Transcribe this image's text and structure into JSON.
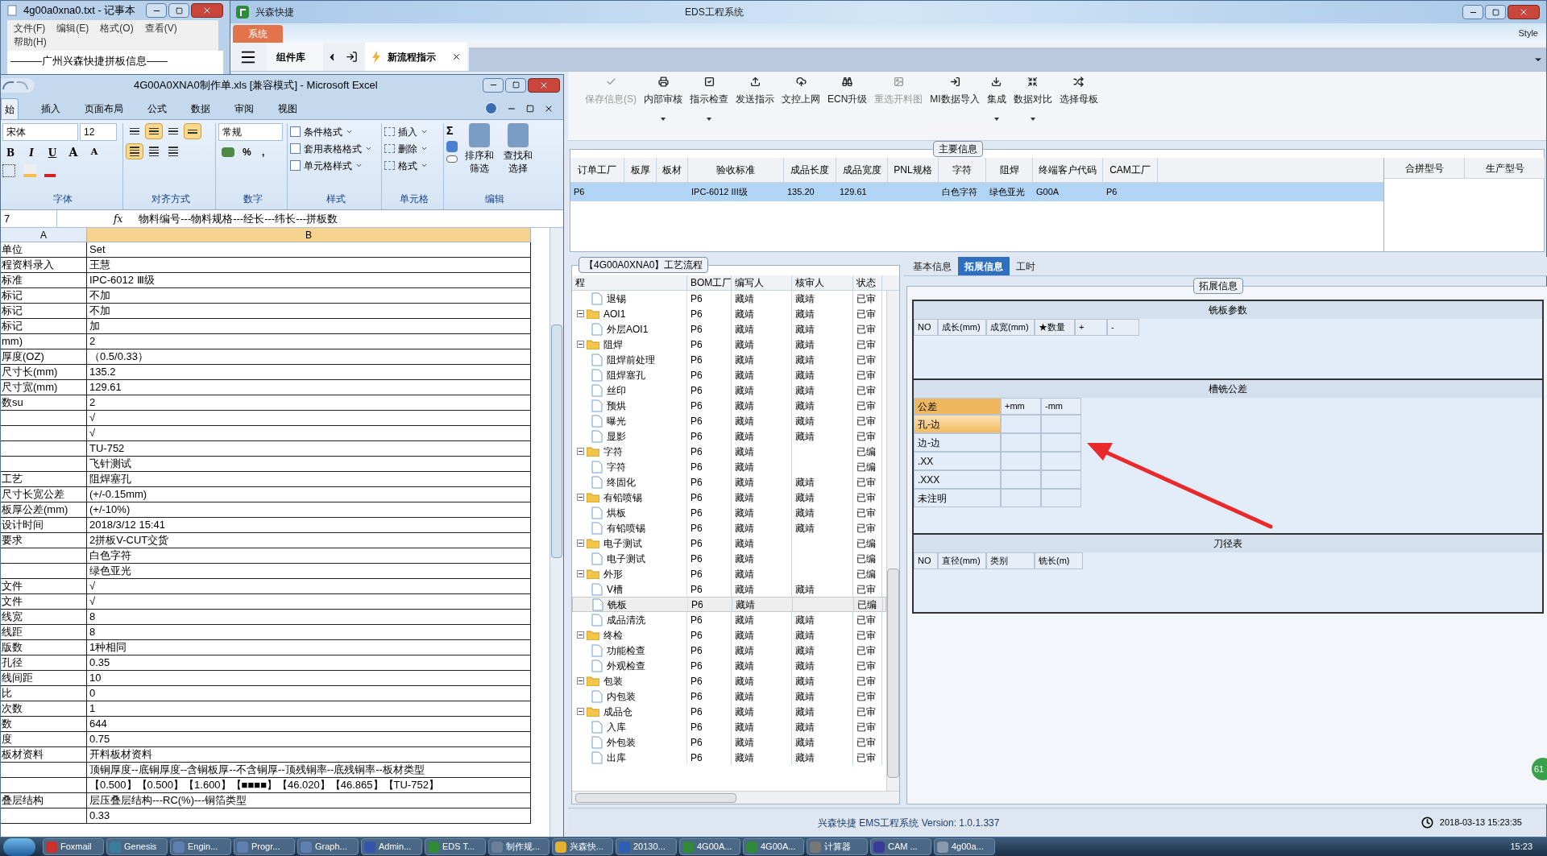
{
  "notepad": {
    "title": "4g00a0xna0.txt - 记事本",
    "menu": [
      "文件(F)",
      "编辑(E)",
      "格式(O)",
      "查看(V)",
      "帮助(H)"
    ],
    "text": "———广州兴森快捷拼板信息——"
  },
  "eds": {
    "app_name": "兴森快捷",
    "title": "EDS工程系统",
    "background_text": "Style",
    "system_tab": "系统",
    "library": "组件库",
    "doc_tabs": [
      {
        "label": "新流程指示",
        "selected": true
      }
    ],
    "toolbar": [
      {
        "label": "保存信息(S)",
        "disabled": true,
        "dropdown": false
      },
      {
        "label": "内部审核",
        "disabled": false,
        "dropdown": true
      },
      {
        "label": "指示检查",
        "disabled": false,
        "dropdown": true
      },
      {
        "label": "发送指示",
        "disabled": false,
        "dropdown": false
      },
      {
        "label": "文控上网",
        "disabled": false,
        "dropdown": false
      },
      {
        "label": "ECN升级",
        "disabled": false,
        "dropdown": false
      },
      {
        "label": "重选开料图",
        "disabled": true,
        "dropdown": false
      },
      {
        "label": "MI数据导入",
        "disabled": false,
        "dropdown": false
      },
      {
        "label": "集成",
        "disabled": false,
        "dropdown": true
      },
      {
        "label": "数据对比",
        "disabled": false,
        "dropdown": true
      },
      {
        "label": "选择母板",
        "disabled": false,
        "dropdown": false
      }
    ],
    "main_info": {
      "title": "主要信息",
      "columns": [
        "订单工厂",
        "板厚",
        "板材",
        "验收标准",
        "成品长度",
        "成品宽度",
        "PNL规格",
        "字符",
        "阻焊",
        "终端客户代码",
        "CAM工厂"
      ],
      "rows": [
        {
          "selected": true,
          "cells": [
            "P6",
            "",
            "",
            "IPC-6012 III级",
            "135.20",
            "129.61",
            "",
            "白色字符",
            "绿色亚光",
            "G00A",
            "P6"
          ]
        }
      ],
      "side_columns": [
        "合拼型号",
        "生产型号"
      ]
    },
    "process": {
      "title": "【4G00A0XNA0】工艺流程",
      "columns": [
        "程",
        "BOM工厂",
        "编写人",
        "核审人",
        "状态"
      ],
      "tree": [
        {
          "children": [
            {
              "name": "退锡",
              "kind": "file",
              "bom": "P6",
              "writer": "藏靖",
              "reviewer": "藏靖",
              "status": "已审",
              "selected": false
            }
          ]
        },
        {
          "name": "AOI1",
          "kind": "folder",
          "expanded": true,
          "bom": "P6",
          "writer": "藏靖",
          "reviewer": "藏靖",
          "status": "已审",
          "selected": false,
          "children": [
            {
              "name": "外层AOI1",
              "kind": "file",
              "bom": "P6",
              "writer": "藏靖",
              "reviewer": "藏靖",
              "status": "已审",
              "selected": false
            }
          ]
        },
        {
          "name": "阻焊",
          "kind": "folder",
          "expanded": true,
          "bom": "P6",
          "writer": "藏靖",
          "reviewer": "藏靖",
          "status": "已审",
          "selected": false,
          "children": [
            {
              "name": "阻焊前处理",
              "kind": "file",
              "bom": "P6",
              "writer": "藏靖",
              "reviewer": "藏靖",
              "status": "已审",
              "selected": false
            },
            {
              "name": "阻焊塞孔",
              "kind": "file",
              "bom": "P6",
              "writer": "藏靖",
              "reviewer": "藏靖",
              "status": "已审",
              "selected": false
            },
            {
              "name": "丝印",
              "kind": "file",
              "bom": "P6",
              "writer": "藏靖",
              "reviewer": "藏靖",
              "status": "已审",
              "selected": false
            },
            {
              "name": "预烘",
              "kind": "file",
              "bom": "P6",
              "writer": "藏靖",
              "reviewer": "藏靖",
              "status": "已审",
              "selected": false
            },
            {
              "name": "曝光",
              "kind": "file",
              "bom": "P6",
              "writer": "藏靖",
              "reviewer": "藏靖",
              "status": "已审",
              "selected": false
            },
            {
              "name": "显影",
              "kind": "file",
              "bom": "P6",
              "writer": "藏靖",
              "reviewer": "藏靖",
              "status": "已审",
              "selected": false
            }
          ]
        },
        {
          "name": "字符",
          "kind": "folder",
          "expanded": true,
          "bom": "P6",
          "writer": "藏靖",
          "status": "已编",
          "selected": false,
          "children": [
            {
              "name": "字符",
              "kind": "file",
              "bom": "P6",
              "writer": "藏靖",
              "status": "已编",
              "selected": false
            },
            {
              "name": "终固化",
              "kind": "file",
              "bom": "P6",
              "writer": "藏靖",
              "reviewer": "藏靖",
              "status": "已审",
              "selected": false
            }
          ]
        },
        {
          "name": "有铅喷锡",
          "kind": "folder",
          "expanded": true,
          "bom": "P6",
          "writer": "藏靖",
          "reviewer": "藏靖",
          "status": "已审",
          "selected": false,
          "children": [
            {
              "name": "烘板",
              "kind": "file",
              "bom": "P6",
              "writer": "藏靖",
              "reviewer": "藏靖",
              "status": "已审",
              "selected": false
            },
            {
              "name": "有铅喷锡",
              "kind": "file",
              "bom": "P6",
              "writer": "藏靖",
              "reviewer": "藏靖",
              "status": "已审",
              "selected": false
            }
          ]
        },
        {
          "name": "电子测试",
          "kind": "folder",
          "expanded": true,
          "bom": "P6",
          "writer": "藏靖",
          "status": "已编",
          "selected": false,
          "children": [
            {
              "name": "电子测试",
              "kind": "file",
              "bom": "P6",
              "writer": "藏靖",
              "status": "已编",
              "selected": false
            }
          ]
        },
        {
          "name": "外形",
          "kind": "folder",
          "expanded": true,
          "bom": "P6",
          "writer": "藏靖",
          "status": "已编",
          "selected": false,
          "children": [
            {
              "name": "V槽",
              "kind": "file",
              "bom": "P6",
              "writer": "藏靖",
              "reviewer": "藏靖",
              "status": "已审",
              "selected": false
            },
            {
              "name": "铣板",
              "kind": "file",
              "bom": "P6",
              "writer": "藏靖",
              "status": "已编",
              "selected": true
            },
            {
              "name": "成品清洗",
              "kind": "file",
              "bom": "P6",
              "writer": "藏靖",
              "reviewer": "藏靖",
              "status": "已审",
              "selected": false
            }
          ]
        },
        {
          "name": "终检",
          "kind": "folder",
          "expanded": true,
          "bom": "P6",
          "writer": "藏靖",
          "reviewer": "藏靖",
          "status": "已审",
          "selected": false,
          "children": [
            {
              "name": "功能检查",
              "kind": "file",
              "bom": "P6",
              "writer": "藏靖",
              "reviewer": "藏靖",
              "status": "已审",
              "selected": false
            },
            {
              "name": "外观检查",
              "kind": "file",
              "bom": "P6",
              "writer": "藏靖",
              "reviewer": "藏靖",
              "status": "已审",
              "selected": false
            }
          ]
        },
        {
          "name": "包装",
          "kind": "folder",
          "expanded": true,
          "bom": "P6",
          "writer": "藏靖",
          "reviewer": "藏靖",
          "status": "已审",
          "selected": false,
          "children": [
            {
              "name": "内包装",
              "kind": "file",
              "bom": "P6",
              "writer": "藏靖",
              "reviewer": "藏靖",
              "status": "已审",
              "selected": false
            }
          ]
        },
        {
          "name": "成品仓",
          "kind": "folder",
          "expanded": true,
          "bom": "P6",
          "writer": "藏靖",
          "reviewer": "藏靖",
          "status": "已审",
          "selected": false,
          "children": [
            {
              "name": "入库",
              "kind": "file",
              "bom": "P6",
              "writer": "藏靖",
              "reviewer": "藏靖",
              "status": "已审",
              "selected": false
            },
            {
              "name": "外包装",
              "kind": "file",
              "bom": "P6",
              "writer": "藏靖",
              "reviewer": "藏靖",
              "status": "已审",
              "selected": false
            },
            {
              "name": "出库",
              "kind": "file",
              "bom": "P6",
              "writer": "藏靖",
              "reviewer": "藏靖",
              "status": "已审",
              "selected": false
            }
          ]
        }
      ]
    },
    "detail": {
      "tabs": [
        {
          "label": "基本信息",
          "selected": false
        },
        {
          "label": "拓展信息",
          "selected": true
        },
        {
          "label": "工时",
          "selected": false
        }
      ],
      "group_title": "拓展信息",
      "milling": {
        "title": "铣板参数",
        "columns": [
          "NO",
          "成长(mm)",
          "成宽(mm)",
          "★数量",
          "+",
          "-"
        ]
      },
      "tolerance": {
        "title": "槽铣公差",
        "columns": [
          "公差",
          "+mm",
          "-mm"
        ],
        "rows": [
          {
            "label": "孔-边",
            "selected": true
          },
          {
            "label": "边-边",
            "selected": false
          },
          {
            "label": ".XX",
            "selected": false
          },
          {
            "label": ".XXX",
            "selected": false
          },
          {
            "label": "未注明",
            "selected": false
          }
        ]
      },
      "tools": {
        "title": "刀径表",
        "columns": [
          "NO",
          "直径(mm)",
          "类别",
          "铣长(m)"
        ]
      }
    },
    "status_bar": {
      "text": "兴森快捷 EMS工程系统 Version: 1.0.1.337",
      "datetime": "2018-03-13 15:23:35"
    },
    "badge": "61"
  },
  "excel": {
    "title": "4G00A0XNA0制作单.xls  [兼容模式] - Microsoft Excel",
    "tabs": [
      {
        "label": "始",
        "selected": true
      },
      {
        "label": "插入",
        "selected": false
      },
      {
        "label": "页面布局",
        "selected": false
      },
      {
        "label": "公式",
        "selected": false
      },
      {
        "label": "数据",
        "selected": false
      },
      {
        "label": "审阅",
        "selected": false
      },
      {
        "label": "视图",
        "selected": false
      }
    ],
    "ribbon": {
      "font": {
        "label": "字体",
        "font": "宋体",
        "size": "12",
        "styles": [
          "B",
          "I",
          "U"
        ],
        "grow": [
          "A",
          "A"
        ]
      },
      "alignment": {
        "label": "对齐方式",
        "vertical": [
          {
            "selected": false
          },
          {
            "selected": true
          },
          {
            "selected": false
          }
        ],
        "wrap": {
          "selected": true
        },
        "horizontal": [
          {
            "selected": true
          },
          {
            "selected": false
          },
          {
            "selected": false
          }
        ]
      },
      "number": {
        "label": "数字",
        "format": "常规",
        "symbols": [
          "%",
          ","
        ]
      },
      "styles": {
        "label": "样式",
        "items": [
          "条件格式",
          "套用表格格式",
          "单元格样式"
        ]
      },
      "cells": {
        "label": "单元格",
        "items": [
          "插入",
          "删除",
          "格式"
        ]
      },
      "editing": {
        "label": "编辑",
        "sum": "Σ",
        "items": [
          "排序和筛选",
          "查找和选择"
        ]
      }
    },
    "name_box": "7",
    "function_label": "fx",
    "formula": "物料编号---物料规格---经长---纬长---拼板数",
    "columns": [
      "A",
      "B"
    ],
    "rows": [
      {
        "a": "单位",
        "b": "Set"
      },
      {
        "a": "程资料录入",
        "b": "王慧"
      },
      {
        "a": "标准",
        "b": "IPC-6012 Ⅲ级"
      },
      {
        "a": "标记",
        "b": "不加"
      },
      {
        "a": "标记",
        "b": "不加"
      },
      {
        "a": "标记",
        "b": "加"
      },
      {
        "a": "mm)",
        "b": "2"
      },
      {
        "a": "厚度(OZ)",
        "b": "（0.5/0.33）"
      },
      {
        "a": "尺寸长(mm)",
        "b": "135.2"
      },
      {
        "a": "尺寸宽(mm)",
        "b": "129.61"
      },
      {
        "a": "数su",
        "b": "2"
      },
      {
        "b": "√"
      },
      {
        "b": "√"
      },
      {
        "b": "TU-752"
      },
      {
        "b": "飞针测试"
      },
      {
        "a": "工艺",
        "b": "阻焊塞孔"
      },
      {
        "a": "尺寸长宽公差",
        "b": "(+/-0.15mm)"
      },
      {
        "a": "板厚公差(mm)",
        "b": "(+/-10%)"
      },
      {
        "a": "设计时间",
        "b": "2018/3/12 15:41"
      },
      {
        "a": "要求",
        "b": "2拼板V-CUT交货"
      },
      {
        "b": "白色字符"
      },
      {
        "b": "绿色亚光"
      },
      {
        "a": "文件",
        "b": "√"
      },
      {
        "a": "文件",
        "b": "√"
      },
      {
        "a": "线宽",
        "b": "8"
      },
      {
        "a": "线距",
        "b": "8"
      },
      {
        "a": "版数",
        "b": "1种相同"
      },
      {
        "a": "孔径",
        "b": "0.35"
      },
      {
        "a": "线间距",
        "b": "10"
      },
      {
        "a": "比",
        "b": "0"
      },
      {
        "a": "次数",
        "b": "1"
      },
      {
        "a": "数",
        "b": "644"
      },
      {
        "a": "度",
        "b": "0.75"
      },
      {
        "a": "板材资料",
        "b": "开料板材资料"
      },
      {
        "b": "顶铜厚度--底铜厚度--含铜板厚--不含铜厚--顶残铜率--底残铜率--板材类型"
      },
      {
        "b": "【0.500】【0.500】【1.600】【■■■■】【46.020】【46.865】【TU-752】"
      },
      {
        "a": "叠层结构",
        "b": "层压叠层结构---RC(%)---铜箔类型"
      },
      {
        "b": "0.33"
      }
    ]
  },
  "taskbar": {
    "items": [
      "Foxmail",
      "Genesis",
      "Engin...",
      "Progr...",
      "Graph...",
      "Admin...",
      "EDS T...",
      "制作规...",
      "兴森快...",
      "20130...",
      "4G00A...",
      "4G00A...",
      "计算器",
      "CAM ...",
      "4g00a..."
    ],
    "clock": "15:23"
  }
}
